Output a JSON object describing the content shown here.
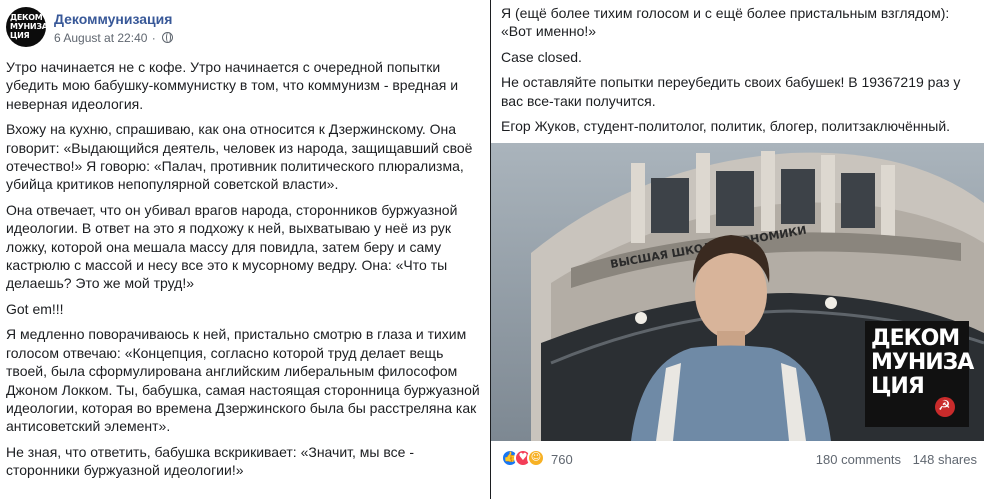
{
  "post": {
    "page_name": "Декоммунизация",
    "timestamp": "6 August at 22:40",
    "avatar_logo_lines": [
      "ДЕКОМ",
      "МУНИЗА",
      "ЦИЯ"
    ],
    "paragraphs": [
      "Утро начинается не с кофе. Утро начинается с очередной попытки убедить мою бабушку-коммунистку в том, что коммунизм - вредная и неверная идеология.",
      "Вхожу на кухню, спрашиваю, как она относится к Дзержинскому. Она говорит: «Выдающийся деятель, человек из народа, защищавший своё отечество!» Я говорю: «Палач, противник политического плюрализма, убийца критиков непопулярной советской власти».",
      "Она отвечает, что он убивал врагов народа, сторонников буржуазной идеологии. В ответ на это я подхожу к ней, выхватываю у неё из рук ложку, которой она мешала массу для повидла, затем беру и саму кастрюлю с массой и несу все это к мусорному ведру. Она: «Что ты делаешь? Это же мой труд!»",
      "Got em!!!",
      "Я медленно поворачиваюсь к ней, пристально смотрю в глаза и тихим голосом отвечаю: «Концепция, согласно которой труд делает вещь твоей, была сформулирована английским либеральным философом Джоном Локком. Ты, бабушка, самая настоящая сторонница буржуазной идеологии, которая во времена Дзержинского была бы расстреляна как антисоветский элемент».",
      "Не зная, что ответить, бабушка вскрикивает: «Значит, мы все - сторонники буржуазной идеологии!»"
    ],
    "continued_paragraphs": [
      "Я (ещё более тихим голосом и с ещё более пристальным взглядом): «Вот именно!»",
      "Case closed.",
      "Не оставляйте попытки переубедить своих бабушек! В 19367219 раз у вас все-таки получится.",
      "Егор Жуков, студент-политолог, политик, блогер, политзаключённый."
    ],
    "photo": {
      "building_sign": "ВЫСШАЯ ШКОЛА ЭКОНОМИКИ",
      "logo_lines": [
        "ДЕКОМ",
        "МУНИЗА",
        "ЦИЯ"
      ]
    },
    "reactions": {
      "icons": [
        "like-icon",
        "love-icon",
        "haha-icon"
      ],
      "count": "760"
    },
    "comments": "180 comments",
    "shares": "148 shares"
  },
  "colors": {
    "page_name": "#385898",
    "meta": "#606770",
    "like": "#1877f2",
    "love": "#f33e58",
    "haha": "#f7b125"
  }
}
